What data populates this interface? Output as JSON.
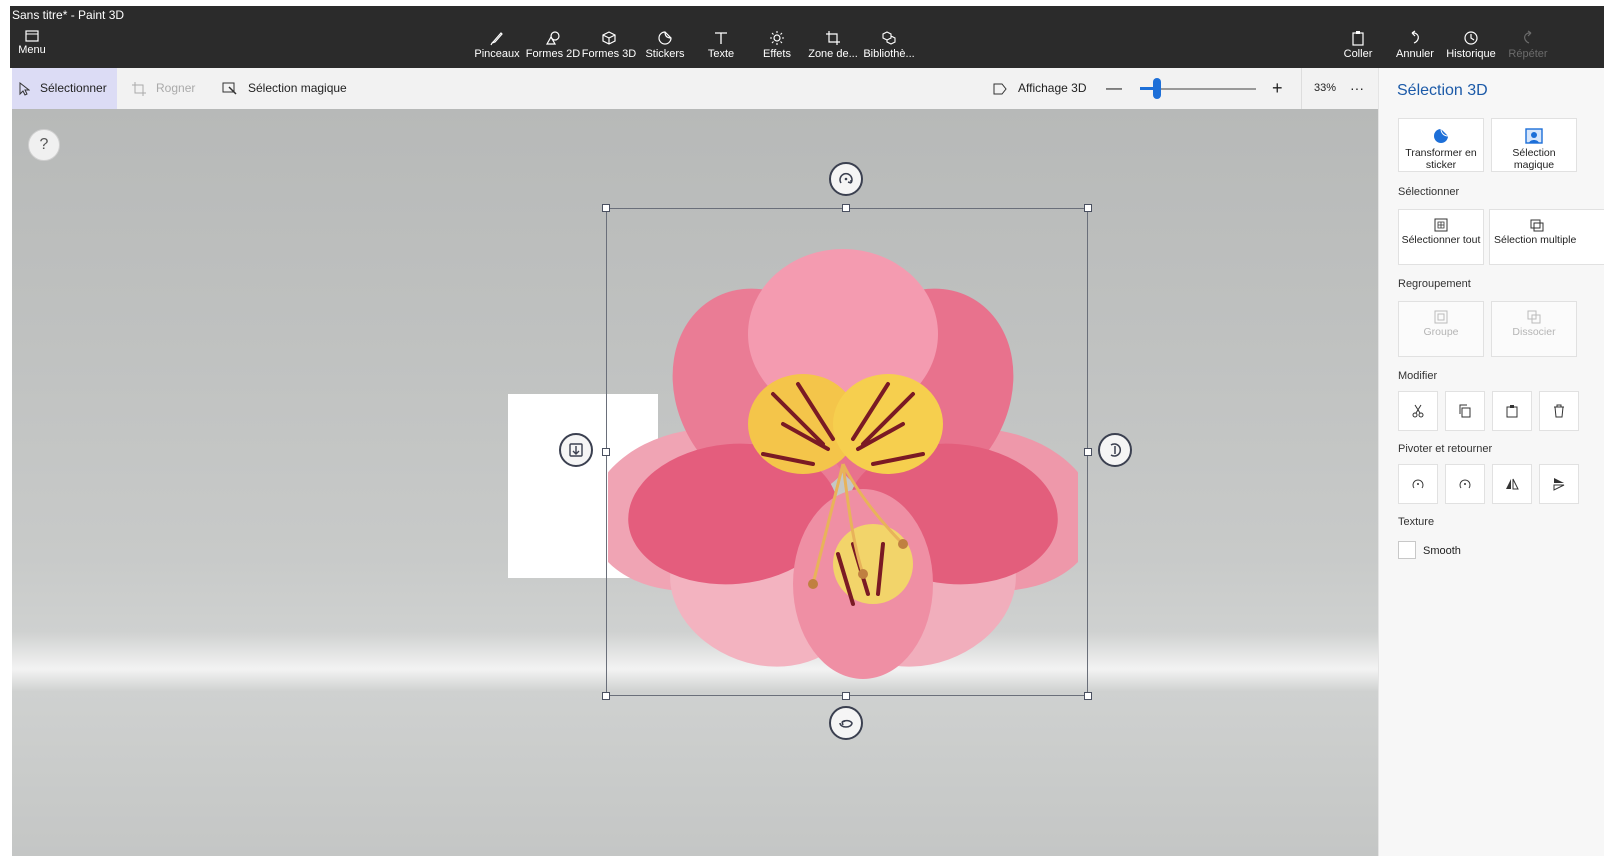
{
  "window": {
    "title": "Sans titre* - Paint 3D"
  },
  "ribbon": {
    "menu_label": "Menu",
    "tools": [
      {
        "label": "Pinceaux",
        "icon": "brush-icon"
      },
      {
        "label": "Formes 2D",
        "icon": "shapes-2d-icon"
      },
      {
        "label": "Formes 3D",
        "icon": "cube-icon"
      },
      {
        "label": "Stickers",
        "icon": "sticker-icon"
      },
      {
        "label": "Texte",
        "icon": "text-icon"
      },
      {
        "label": "Effets",
        "icon": "effects-sun-icon"
      },
      {
        "label": "Zone de...",
        "icon": "canvas-crop-icon"
      },
      {
        "label": "Bibliothè...",
        "icon": "library-icon"
      }
    ],
    "actions": [
      {
        "label": "Coller",
        "icon": "paste-icon"
      },
      {
        "label": "Annuler",
        "icon": "undo-icon"
      },
      {
        "label": "Historique",
        "icon": "history-icon"
      },
      {
        "label": "Répéter",
        "icon": "redo-icon"
      }
    ]
  },
  "toolbar": {
    "select_label": "Sélectionner",
    "crop_label": "Rogner",
    "magic_select_label": "Sélection magique",
    "view3d_label": "Affichage 3D",
    "zoom_percent": "33%",
    "zoom_level": 0.15,
    "more_label": "···"
  },
  "canvas": {
    "help_label": "?"
  },
  "panel": {
    "title": "Sélection 3D",
    "top_buttons": [
      {
        "label": "Transformer en sticker"
      },
      {
        "label": "Sélection magique"
      }
    ],
    "select_section": "Sélectionner",
    "select_buttons": [
      {
        "label": "Sélectionner tout"
      },
      {
        "label": "Sélection multiple"
      }
    ],
    "group_section": "Regroupement",
    "group_buttons": [
      {
        "label": "Groupe"
      },
      {
        "label": "Dissocier"
      }
    ],
    "modify_section": "Modifier",
    "rotate_section": "Pivoter et retourner",
    "texture_section": "Texture",
    "smooth_label": "Smooth"
  },
  "colors": {
    "accent": "#1d6fd8",
    "panel_title": "#1c5aa8",
    "ribbon": "#2b2b2b"
  }
}
